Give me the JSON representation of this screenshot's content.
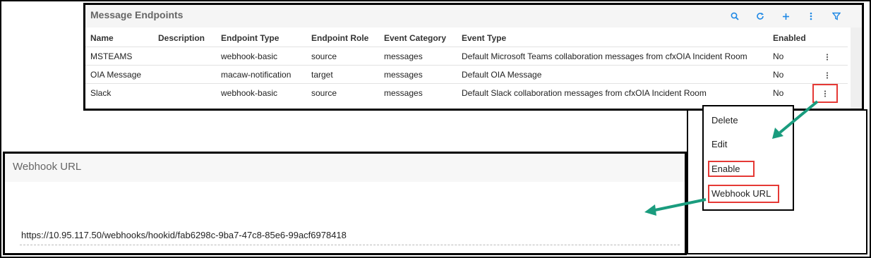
{
  "endpoints_panel": {
    "title": "Message Endpoints",
    "toolbar": [
      {
        "icon": "search-icon"
      },
      {
        "icon": "refresh-icon"
      },
      {
        "icon": "add-icon"
      },
      {
        "icon": "more-vertical-icon"
      },
      {
        "icon": "filter-icon"
      }
    ],
    "columns": [
      "Name",
      "Description",
      "Endpoint Type",
      "Endpoint Role",
      "Event Category",
      "Event Type",
      "Enabled"
    ],
    "rows": [
      {
        "name": "MSTEAMS",
        "description": "",
        "endpoint_type": "webhook-basic",
        "endpoint_role": "source",
        "event_category": "messages",
        "event_type": "Default Microsoft Teams collaboration messages from cfxOIA Incident Room",
        "enabled": "No"
      },
      {
        "name": "OIA Message",
        "description": "",
        "endpoint_type": "macaw-notification",
        "endpoint_role": "target",
        "event_category": "messages",
        "event_type": "Default OIA Message",
        "enabled": "No"
      },
      {
        "name": "Slack",
        "description": "",
        "endpoint_type": "webhook-basic",
        "endpoint_role": "source",
        "event_category": "messages",
        "event_type": "Default Slack collaboration messages from cfxOIA Incident Room",
        "enabled": "No"
      }
    ]
  },
  "context_menu": {
    "items": [
      "Delete",
      "Edit",
      "Enable",
      "Webhook URL"
    ]
  },
  "webhook_panel": {
    "title": "Webhook URL",
    "url": "https://10.95.117.50/webhooks/hookid/fab6298c-9ba7-47c8-85e6-99acf6978418"
  },
  "colors": {
    "accent": "#1e88e5",
    "highlight": "#e53935",
    "arrow": "#1a9c7e"
  }
}
